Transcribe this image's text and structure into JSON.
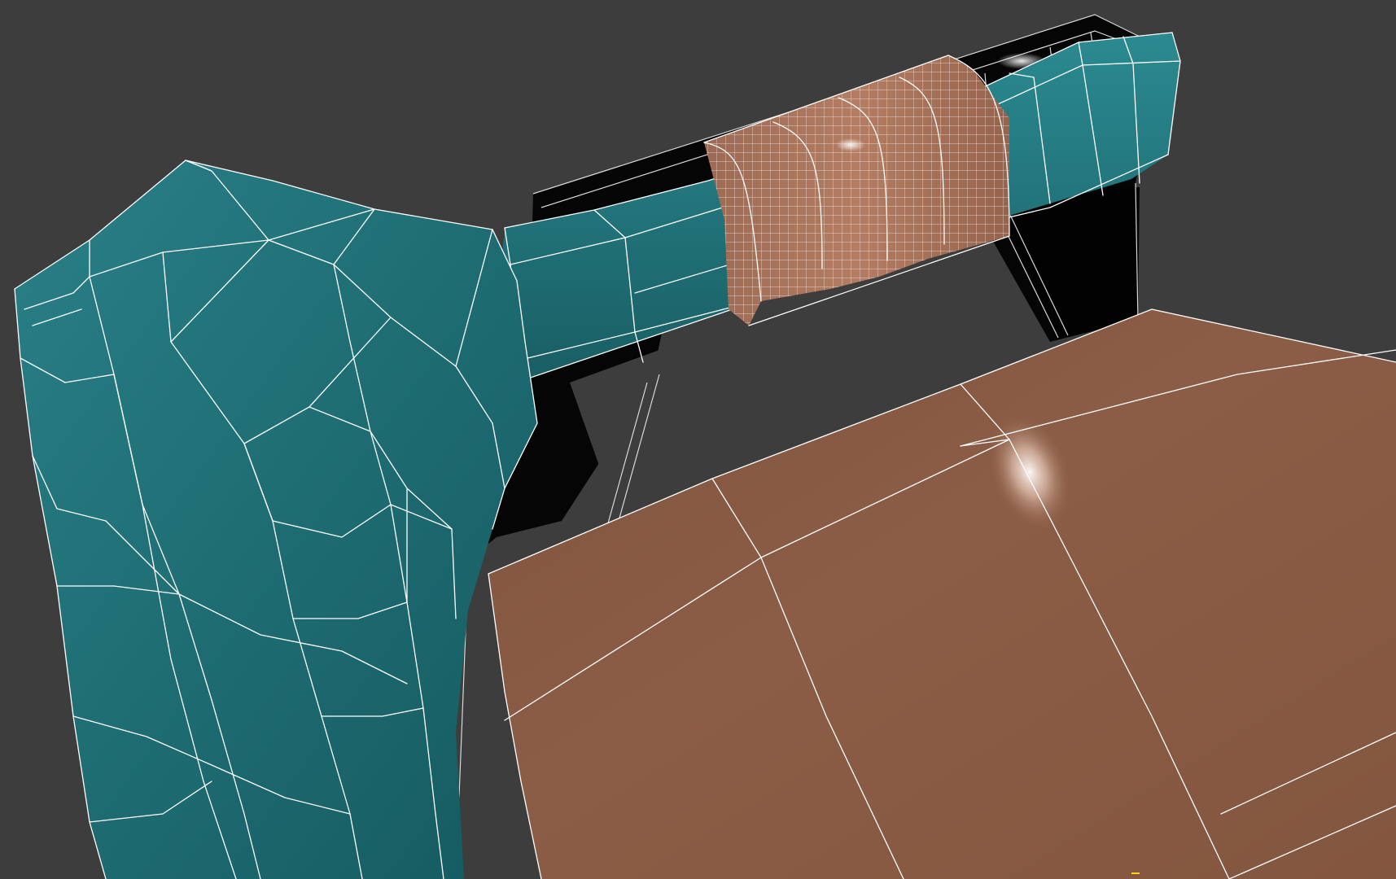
{
  "viewport": {
    "background_color": "#3d3d3d"
  },
  "scene": {
    "objects": [
      {
        "name": "chair-frame",
        "material_color": "#000000",
        "wireframe_color": "#ffffff"
      },
      {
        "name": "backrest-rail",
        "material_color": "#1d6a70",
        "wireframe_color": "#ffffff"
      },
      {
        "name": "draped-cloth",
        "material_color": "#1f6d72",
        "wireframe_color": "#ffffff"
      },
      {
        "name": "wrapped-straps",
        "material_color": "#a9735a",
        "wireframe_color": "#ffffff"
      },
      {
        "name": "seat-cushion",
        "material_color": "#8a5a43",
        "wireframe_color": "#ffffff"
      }
    ],
    "selection_highlight_color": "#ffd400"
  }
}
